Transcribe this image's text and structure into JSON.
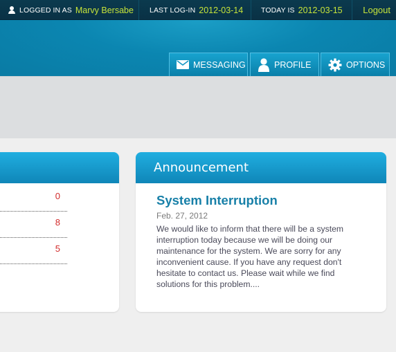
{
  "topbar": {
    "logged_in_label": "LOGGED IN AS",
    "user_name": "Marvy Bersabe",
    "last_login_label": "LAST LOG-IN",
    "last_login_value": "2012-03-14",
    "today_label": "TODAY IS",
    "today_value": "2012-03-15",
    "logout_label": "Logout"
  },
  "nav": {
    "messaging": "MESSAGING",
    "profile": "PROFILE",
    "options": "OPTIONS"
  },
  "left_panel": {
    "counts": [
      "0",
      "8",
      "5"
    ]
  },
  "announcement": {
    "header": "Announcement",
    "title": "System Interruption",
    "date": "Feb. 27, 2012",
    "body": "We would like to inform that there will be a system interruption today because we will be doing our maintenance for the system. We are sorry for any inconvenient cause. If you have any request don't hesitate to contact us. Please wait while we find solutions for this problem...."
  },
  "colors": {
    "accent_green": "#c6e33a",
    "header_blue": "#0b86b1",
    "count_red": "#d22b2b",
    "title_blue": "#1880a8"
  },
  "icons": [
    "user-icon",
    "envelope-icon",
    "person-icon",
    "gear-icon"
  ]
}
